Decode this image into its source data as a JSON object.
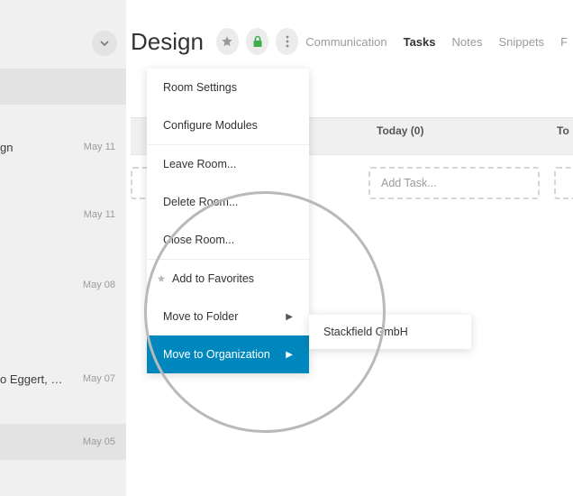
{
  "room": {
    "title": "Design"
  },
  "tabs": {
    "items": [
      "Communication",
      "Tasks",
      "Notes",
      "Snippets"
    ],
    "trailing": "F",
    "active": "Tasks"
  },
  "columns": {
    "today": {
      "label": "Today (0)",
      "add_placeholder": "Add Task..."
    },
    "tomorrow": {
      "label_abbrev": "To",
      "add_placeholder": "Add Task..."
    },
    "left": {
      "add_placeholder": "Add Task..."
    }
  },
  "sidebar": {
    "items": [
      {
        "label": "gn",
        "date": "May 11"
      },
      {
        "label": "",
        "date": "May 11"
      },
      {
        "label": "",
        "date": "May 08"
      },
      {
        "label": "o Eggert, …",
        "date": "May 07"
      },
      {
        "label": "",
        "date": "May 05"
      }
    ]
  },
  "dropdown": {
    "group1": [
      "Room Settings",
      "Configure Modules"
    ],
    "group2": [
      "Leave Room...",
      "Delete Room...",
      "Close Room..."
    ],
    "group3": {
      "favorites": "Add to Favorites",
      "move_folder": "Move to Folder",
      "move_org": "Move to Organization"
    }
  },
  "submenu": {
    "org": "Stackfield GmbH"
  }
}
